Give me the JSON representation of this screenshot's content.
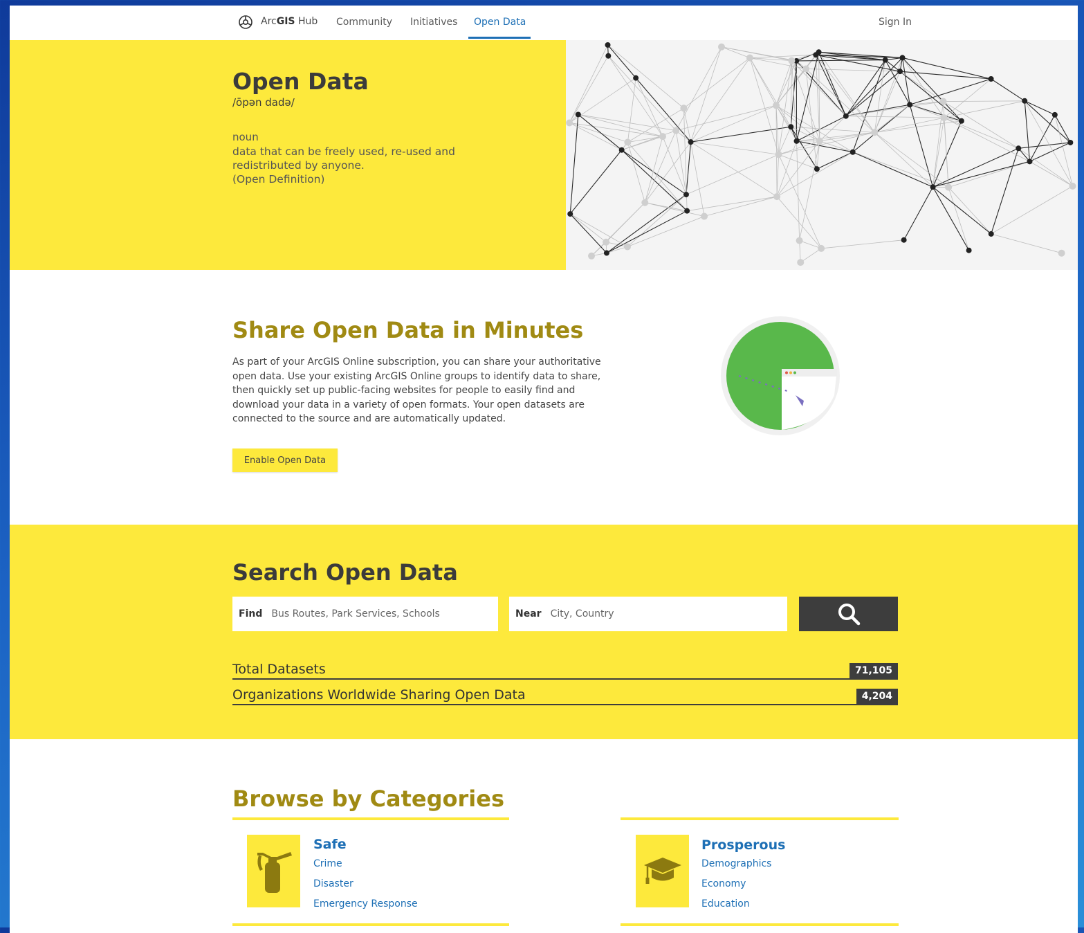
{
  "nav": {
    "brand_prefix": "Arc",
    "brand_bold": "GIS",
    "brand_suffix": " Hub",
    "links": [
      "Community",
      "Initiatives",
      "Open Data"
    ],
    "active_link": "Open Data",
    "sign_in": "Sign In"
  },
  "hero": {
    "title": "Open Data",
    "phonetic": "/ōpən dadə/",
    "part_of_speech": "noun",
    "definition_lines": [
      "data that can be freely used, re-used and",
      "redistributed by anyone.",
      "(Open Definition)"
    ]
  },
  "share": {
    "title": "Share Open Data in Minutes",
    "text_lines": [
      "As part of your ArcGIS Online subscription, you can share your authoritative",
      "open data. Use your existing ArcGIS Online groups to identify data to share,",
      "then quickly set up public-facing websites for people to easily find and",
      "download your data in a variety of open formats. Your open datasets are",
      "connected to the source and are automatically updated."
    ],
    "button": "Enable Open Data"
  },
  "search": {
    "title": "Search Open Data",
    "find_label": "Find",
    "find_placeholder": "Bus Routes, Park Services, Schools",
    "near_label": "Near",
    "near_placeholder": "City, Country",
    "stats": [
      {
        "label": "Total Datasets",
        "value": "71,105"
      },
      {
        "label": "Organizations Worldwide Sharing Open Data",
        "value": "4,204"
      }
    ]
  },
  "browse": {
    "title": "Browse by Categories",
    "categories": [
      {
        "name": "Safe",
        "icon": "fire-extinguisher-icon",
        "items": [
          "Crime",
          "Disaster",
          "Emergency Response"
        ]
      },
      {
        "name": "Prosperous",
        "icon": "graduation-cap-icon",
        "items": [
          "Demographics",
          "Economy",
          "Education"
        ]
      }
    ]
  },
  "colors": {
    "yellow": "#fde93c",
    "gold_heading": "#a08a13",
    "link_blue": "#1d6fb5",
    "dark": "#3d3d3d",
    "illustration_green": "#59b84b"
  }
}
